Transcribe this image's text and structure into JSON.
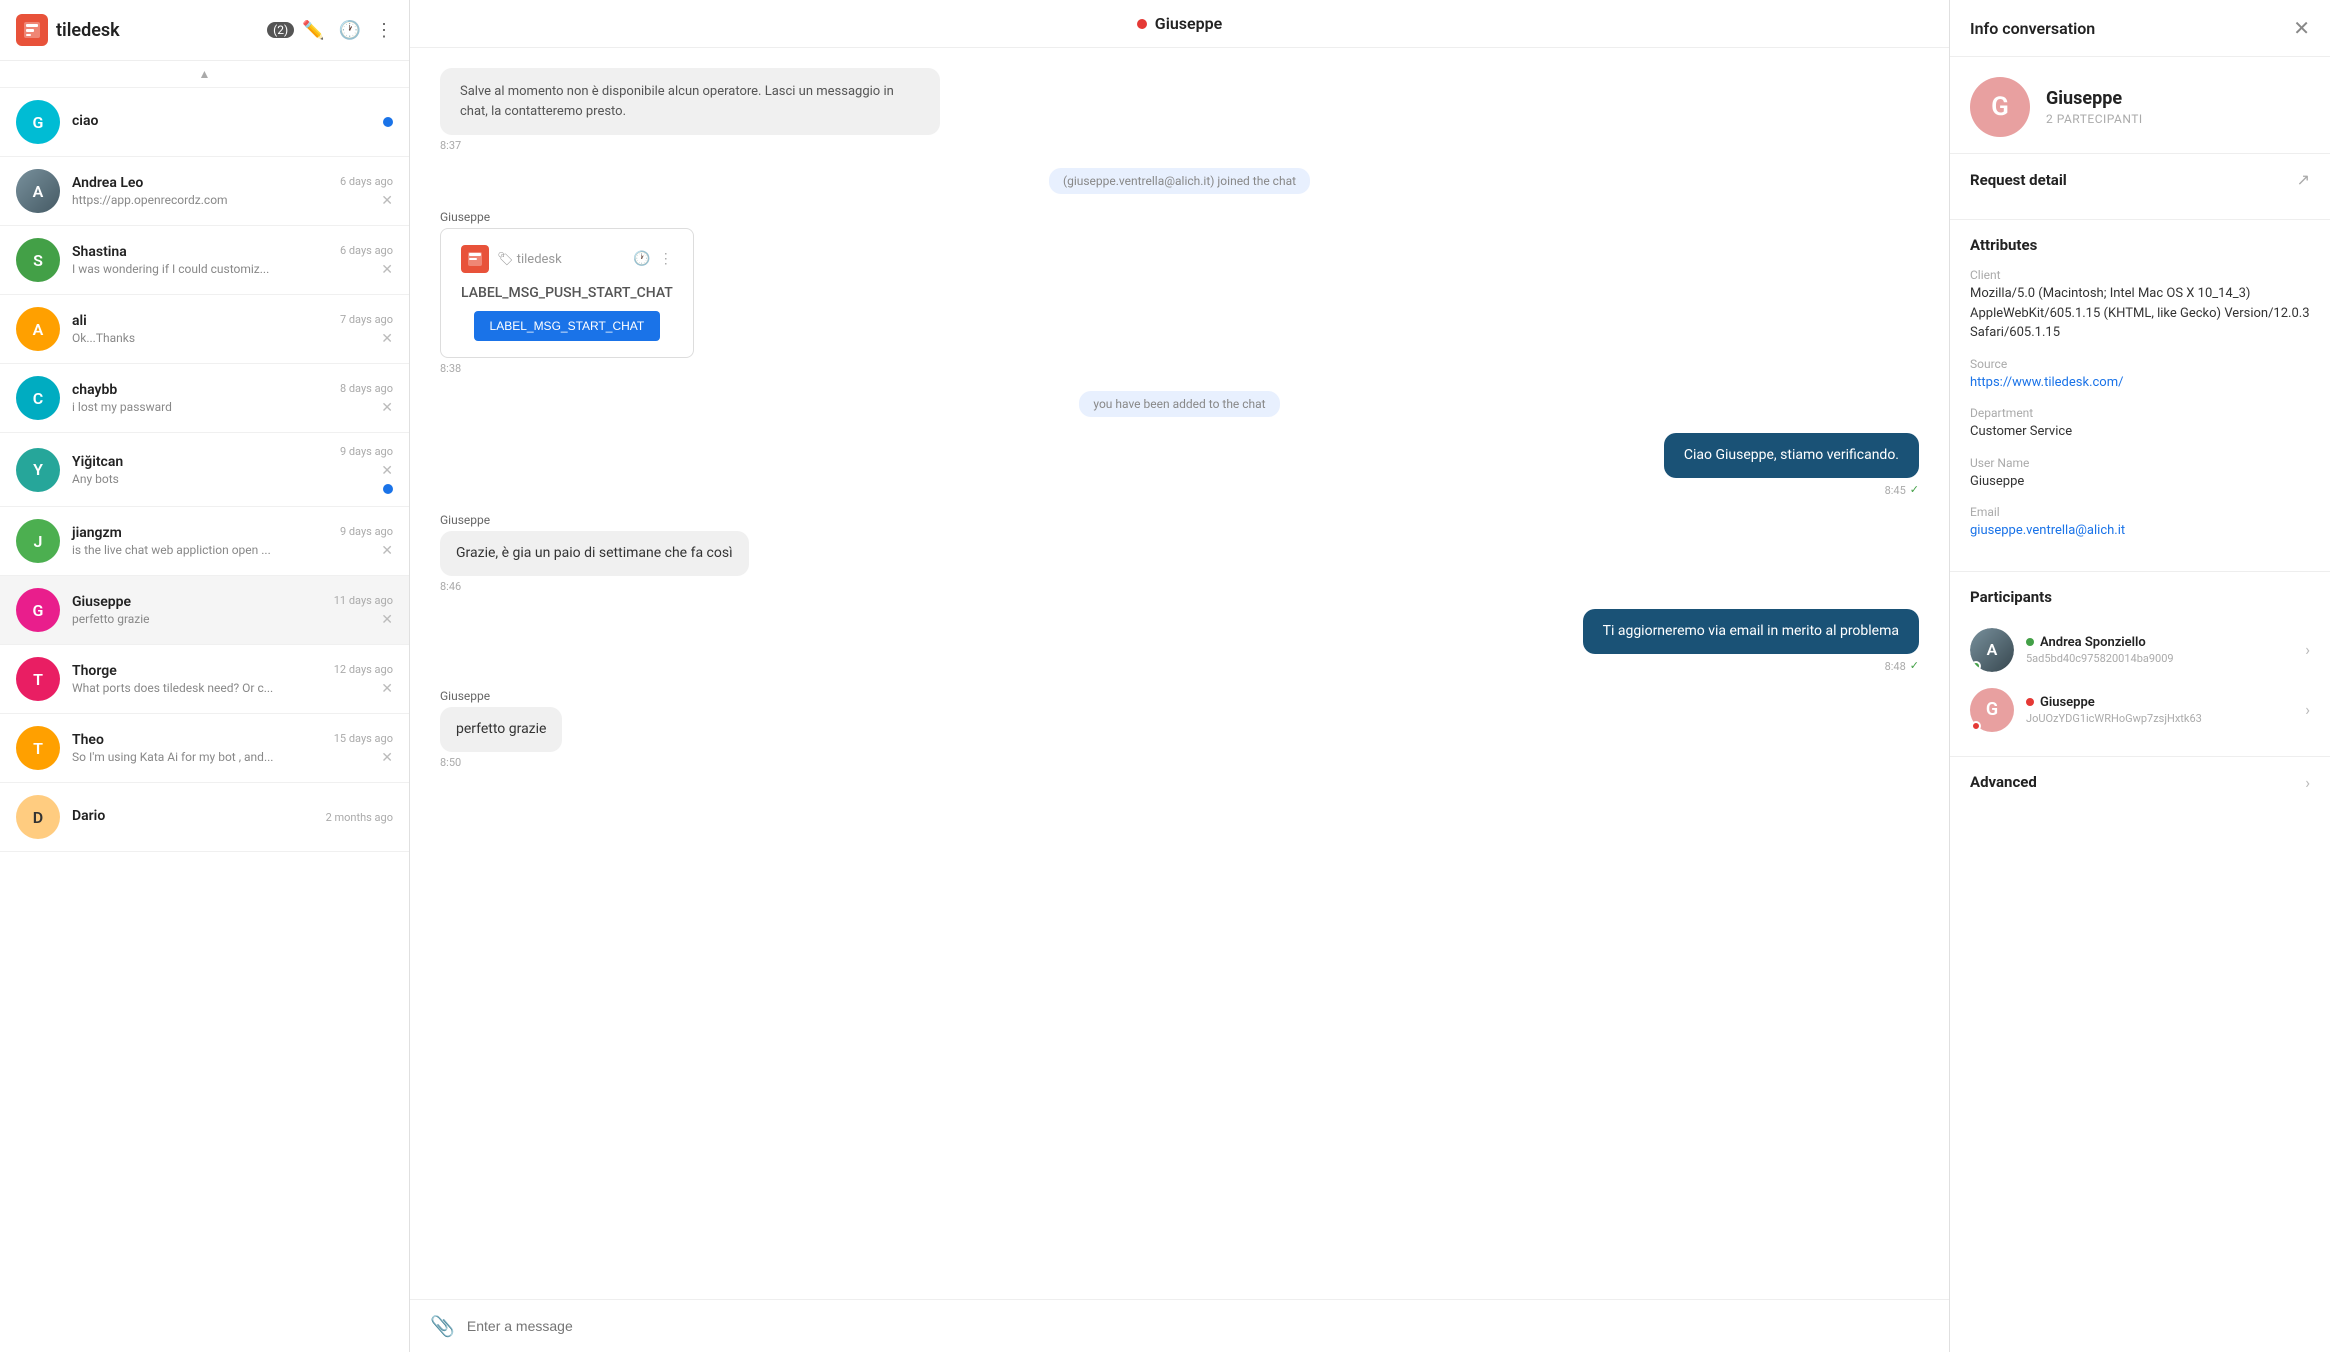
{
  "sidebar": {
    "title": "tiledesk",
    "count": "(2)",
    "conversations": [
      {
        "id": "conv-ciao",
        "initial": "G",
        "color": "#00bcd4",
        "name": "ciao",
        "preview": "",
        "time": "",
        "hasDot": true,
        "showClose": false,
        "isPhoto": false
      },
      {
        "id": "conv-andrea",
        "initial": "A",
        "color": "#607d8b",
        "name": "Andrea Leo",
        "preview": "https://app.openrecordz.com",
        "time": "6 days ago",
        "hasDot": false,
        "showClose": true,
        "isPhoto": true,
        "photoColor": "#607d8b"
      },
      {
        "id": "conv-shastina",
        "initial": "S",
        "color": "#43a047",
        "name": "Shastina",
        "preview": "I was wondering if I could customiz...",
        "time": "6 days ago",
        "hasDot": false,
        "showClose": true,
        "isPhoto": false
      },
      {
        "id": "conv-ali",
        "initial": "A",
        "color": "#ffa000",
        "name": "ali",
        "preview": "Ok...Thanks",
        "time": "7 days ago",
        "hasDot": false,
        "showClose": true,
        "isPhoto": false
      },
      {
        "id": "conv-chaybb",
        "initial": "C",
        "color": "#00acc1",
        "name": "chaybb",
        "preview": "i lost my passward",
        "time": "8 days ago",
        "hasDot": false,
        "showClose": true,
        "isPhoto": false
      },
      {
        "id": "conv-yigitcan",
        "initial": "Y",
        "color": "#26a69a",
        "name": "Yiğitcan",
        "preview": "Any bots",
        "time": "9 days ago",
        "hasDot": true,
        "showClose": true,
        "isPhoto": false
      },
      {
        "id": "conv-jiangzm",
        "initial": "J",
        "color": "#4caf50",
        "name": "jiangzm",
        "preview": "is the live chat web appliction open ...",
        "time": "9 days ago",
        "hasDot": false,
        "showClose": true,
        "isPhoto": false
      },
      {
        "id": "conv-giuseppe",
        "initial": "G",
        "color": "#e91e8c",
        "name": "Giuseppe",
        "preview": "perfetto grazie",
        "time": "11 days ago",
        "hasDot": false,
        "showClose": true,
        "isPhoto": false,
        "active": true
      },
      {
        "id": "conv-thorge",
        "initial": "T",
        "color": "#e91e63",
        "name": "Thorge",
        "preview": "What ports does tiledesk need? Or c...",
        "time": "12 days ago",
        "hasDot": false,
        "showClose": true,
        "isPhoto": false
      },
      {
        "id": "conv-theo",
        "initial": "T",
        "color": "#ffa000",
        "name": "Theo",
        "preview": "So I'm using Kata Ai for my bot , and...",
        "time": "15 days ago",
        "hasDot": false,
        "showClose": true,
        "isPhoto": false
      },
      {
        "id": "conv-dario",
        "initial": "D",
        "color": "#ffcc80",
        "name": "Dario",
        "preview": "",
        "time": "2 months ago",
        "hasDot": false,
        "showClose": false,
        "isPhoto": false
      }
    ]
  },
  "chat": {
    "header_name": "Giuseppe",
    "messages": [
      {
        "type": "system",
        "text": "Salve al momento non è disponibile alcun operatore. Lasci un messaggio in chat, la contatteremo presto.",
        "time": "8:37"
      },
      {
        "type": "join",
        "text": "(giuseppe.ventrella@alich.it) joined the chat"
      },
      {
        "type": "bot",
        "sender": "Giuseppe",
        "logo": "🏷",
        "label": "LABEL_MSG_PUSH_START_CHAT",
        "button": "LABEL_MSG_START_CHAT",
        "time": "8:38"
      },
      {
        "type": "join",
        "text": "you have been added to the chat"
      },
      {
        "type": "right",
        "text": "Ciao Giuseppe, stiamo verificando.",
        "time": "8:45",
        "check": true
      },
      {
        "type": "left",
        "sender": "Giuseppe",
        "text": "Grazie, è gia un paio di settimane che fa così",
        "time": "8:46"
      },
      {
        "type": "right",
        "text": "Ti aggiorneremo via email in merito al problema",
        "time": "8:48",
        "check": true
      },
      {
        "type": "left",
        "sender": "Giuseppe",
        "text": "perfetto grazie",
        "time": "8:50"
      }
    ],
    "input_placeholder": "Enter a message"
  },
  "info": {
    "title": "Info conversation",
    "user_name": "Giuseppe",
    "participants_label": "2 PARTECIPANTI",
    "request_detail": "Request detail",
    "attributes_title": "Attributes",
    "client_label": "Client",
    "client_value": "Mozilla/5.0 (Macintosh; Intel Mac OS X 10_14_3) AppleWebKit/605.1.15 (KHTML, like Gecko) Version/12.0.3 Safari/605.1.15",
    "source_label": "Source",
    "source_value": "https://www.tiledesk.com/",
    "department_label": "Department",
    "department_value": "Customer Service",
    "username_label": "User Name",
    "username_value": "Giuseppe",
    "email_label": "Email",
    "email_value": "giuseppe.ventrella@alich.it",
    "participants_title": "Participants",
    "participant1_name": "Andrea Sponziello",
    "participant1_id": "5ad5bd40c975820014ba9009",
    "participant1_status": "green",
    "participant2_name": "Giuseppe",
    "participant2_id": "JoUOzYDG1icWRHoGwp7zsjHxtk63",
    "participant2_status": "red",
    "advanced_label": "Advanced"
  }
}
